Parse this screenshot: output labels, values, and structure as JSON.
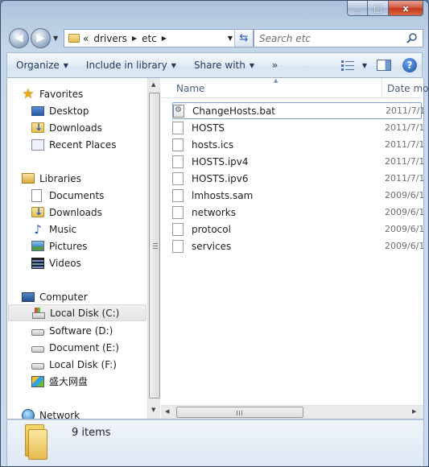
{
  "window": {
    "caption_buttons": [
      "minimize",
      "maximize",
      "close"
    ],
    "close_glyph": "x",
    "maximize_glyph": "□",
    "minimize_glyph": "_"
  },
  "navigation": {
    "back_icon": "back-arrow-icon",
    "forward_icon": "forward-arrow-icon",
    "address": {
      "overflow": "«",
      "crumbs": [
        "drivers",
        "etc"
      ]
    },
    "search_placeholder": "Search etc"
  },
  "toolbar": {
    "organize": "Organize",
    "include_in_library": "Include in library",
    "share_with": "Share with",
    "more": "»"
  },
  "nav_pane": {
    "favorites": {
      "label": "Favorites",
      "items": [
        "Desktop",
        "Downloads",
        "Recent Places"
      ]
    },
    "libraries": {
      "label": "Libraries",
      "items": [
        "Documents",
        "Downloads",
        "Music",
        "Pictures",
        "Videos"
      ]
    },
    "computer": {
      "label": "Computer",
      "items": [
        "Local Disk (C:)",
        "Software (D:)",
        "Document (E:)",
        "Local Disk (F:)",
        "盛大网盘"
      ]
    },
    "network": {
      "label": "Network"
    }
  },
  "file_list": {
    "columns": [
      "Name",
      "Date mod"
    ],
    "files": [
      {
        "name": "ChangeHosts.bat",
        "date": "2011/7/1"
      },
      {
        "name": "HOSTS",
        "date": "2011/7/1"
      },
      {
        "name": "hosts.ics",
        "date": "2011/7/1"
      },
      {
        "name": "HOSTS.ipv4",
        "date": "2011/7/1"
      },
      {
        "name": "HOSTS.ipv6",
        "date": "2011/7/1"
      },
      {
        "name": "lmhosts.sam",
        "date": "2009/6/1"
      },
      {
        "name": "networks",
        "date": "2009/6/1"
      },
      {
        "name": "protocol",
        "date": "2009/6/1"
      },
      {
        "name": "services",
        "date": "2009/6/1"
      }
    ]
  },
  "status": {
    "item_count": "9 items"
  },
  "colors": {
    "toolbar_text": "#1e395b",
    "selection_border": "#7da2ce",
    "header_text": "#4c607a"
  }
}
